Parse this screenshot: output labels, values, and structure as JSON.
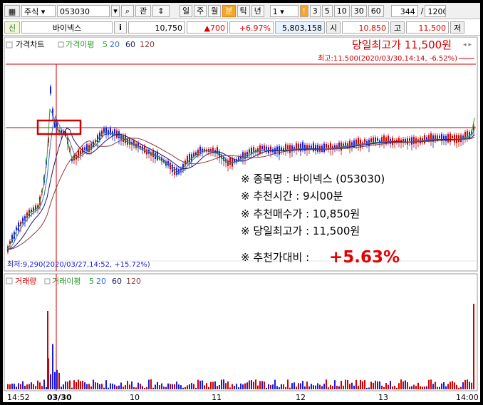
{
  "toolbar": {
    "market_select": "주식",
    "code_input": "053030",
    "search_icon": "search-icon",
    "tab_label": "관",
    "period_buttons": [
      "일",
      "주",
      "월",
      "분",
      "틱",
      "년"
    ],
    "active_period": "분",
    "interval_select": "1",
    "interval_buttons": [
      "3",
      "5",
      "10",
      "30",
      "60"
    ],
    "count_value": "344",
    "count_max": "1200",
    "slash": "/",
    "colors": {
      "active": "#f5a623"
    }
  },
  "quote": {
    "badge": "신",
    "name": "바이넥스",
    "info_button": "i",
    "price": "10,750",
    "change": "▲700",
    "change_pct": "+6.97%",
    "volume": "5,803,158",
    "open_label": "시",
    "open_value": "10,850",
    "high_label": "고",
    "high_value": "11,500",
    "low_label": "저"
  },
  "price_panel": {
    "legend": {
      "title": "가격차트",
      "ma_label": "가격이평",
      "ma_items": [
        {
          "text": "5",
          "color": "#2e9c2e"
        },
        {
          "text": "20",
          "color": "#2f6fd6"
        },
        {
          "text": "60",
          "color": "#1a1a6e"
        },
        {
          "text": "120",
          "color": "#8b3a3a"
        }
      ]
    },
    "headline": "당일최고가 11,500원",
    "high_marker": "최고:11,500(2020/03/30,14:14, -6.52%)",
    "low_marker": "최저:9,290(2020/03/27,14:52, +15.72%)",
    "info": [
      "※ 종목명 : 바이넥스 (053030)",
      "※ 추천시간 : 9시00분",
      "※ 추천매수가 : 10,850원",
      "※ 당일최고가 : 11,500원"
    ],
    "return_label": "※ 추천가대비 :",
    "return_value": "+5.63%",
    "colors": {
      "up": "#d00000",
      "down": "#1a1adc",
      "frame": "#d00000"
    }
  },
  "volume_panel": {
    "legend": {
      "title": "거래량",
      "ma_label": "거래이평",
      "ma_items": [
        {
          "text": "5",
          "color": "#2e9c2e"
        },
        {
          "text": "20",
          "color": "#2f6fd6"
        },
        {
          "text": "60",
          "color": "#1a1a6e"
        },
        {
          "text": "120",
          "color": "#8b3a3a"
        }
      ]
    }
  },
  "x_axis": {
    "labels": [
      "14:52",
      "03/30",
      "10",
      "11",
      "12",
      "13",
      "14:00"
    ],
    "bold_index": 1
  },
  "chart_data": {
    "type": "candlestick",
    "x_categories": [
      "14:52",
      "03/30",
      "10",
      "11",
      "12",
      "13",
      "14:00"
    ],
    "price_range": [
      9290,
      11500
    ],
    "high": {
      "value": 11500,
      "time": "2020/03/30,14:14"
    },
    "low": {
      "value": 9290,
      "time": "2020/03/27,14:52"
    },
    "recommended_buy": 10850,
    "last": 10750,
    "moving_averages": [
      "5",
      "20",
      "60",
      "120"
    ],
    "volume_moving_averages": [
      "5",
      "20",
      "60",
      "120"
    ]
  }
}
